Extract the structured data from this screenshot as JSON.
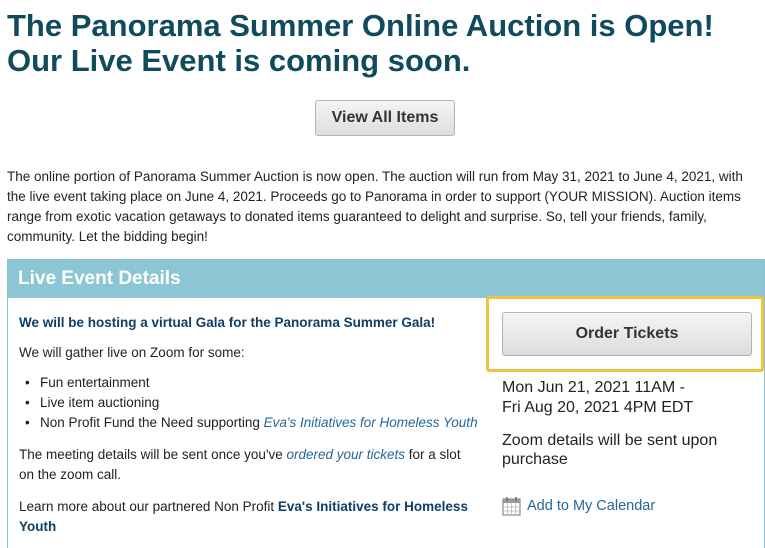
{
  "headline": {
    "line1": "The Panorama Summer Online Auction is Open!",
    "line2": "Our Live Event is coming soon."
  },
  "view_all_button": "View All Items",
  "intro_text": "The online portion of Panorama Summer Auction is now open. The auction will run from May 31, 2021 to June 4, 2021, with the live event taking place on June 4, 2021. Proceeds go to Panorama in order to support (YOUR MISSION). Auction items range from exotic vacation getaways to donated items guaranteed to delight and surprise. So, tell your friends, family, community. Let the bidding begin!",
  "live_event": {
    "header": "Live Event Details",
    "gala_title": "We will be hosting a virtual Gala for the Panorama Summer Gala!",
    "gather_text": "We will gather live on Zoom for some:",
    "bullets": {
      "b1": "Fun entertainment",
      "b2": "Live item auctioning",
      "b3_prefix": "Non Profit Fund the Need supporting ",
      "b3_link": "Eva's Initiatives for Homeless Youth"
    },
    "details_prefix": "The meeting details will be sent once you've ",
    "details_link": "ordered your tickets",
    "details_suffix": " for a slot on the zoom call.",
    "learn_prefix": "Learn more about our partnered Non Profit ",
    "learn_link": "Eva's Initiatives for Homeless Youth",
    "order_button": "Order Tickets",
    "date_line1": "Mon Jun 21, 2021 11AM -",
    "date_line2": "Fri Aug 20, 2021 4PM EDT",
    "zoom_note": "Zoom details will be sent upon purchase",
    "calendar_link": "Add to My Calendar",
    "calendar_icon": "calendar-icon"
  },
  "colors": {
    "headline": "#0f4b5c",
    "panel_header_bg": "#8cc6d4",
    "highlight_border": "#f0c33b",
    "link": "#24679c"
  }
}
